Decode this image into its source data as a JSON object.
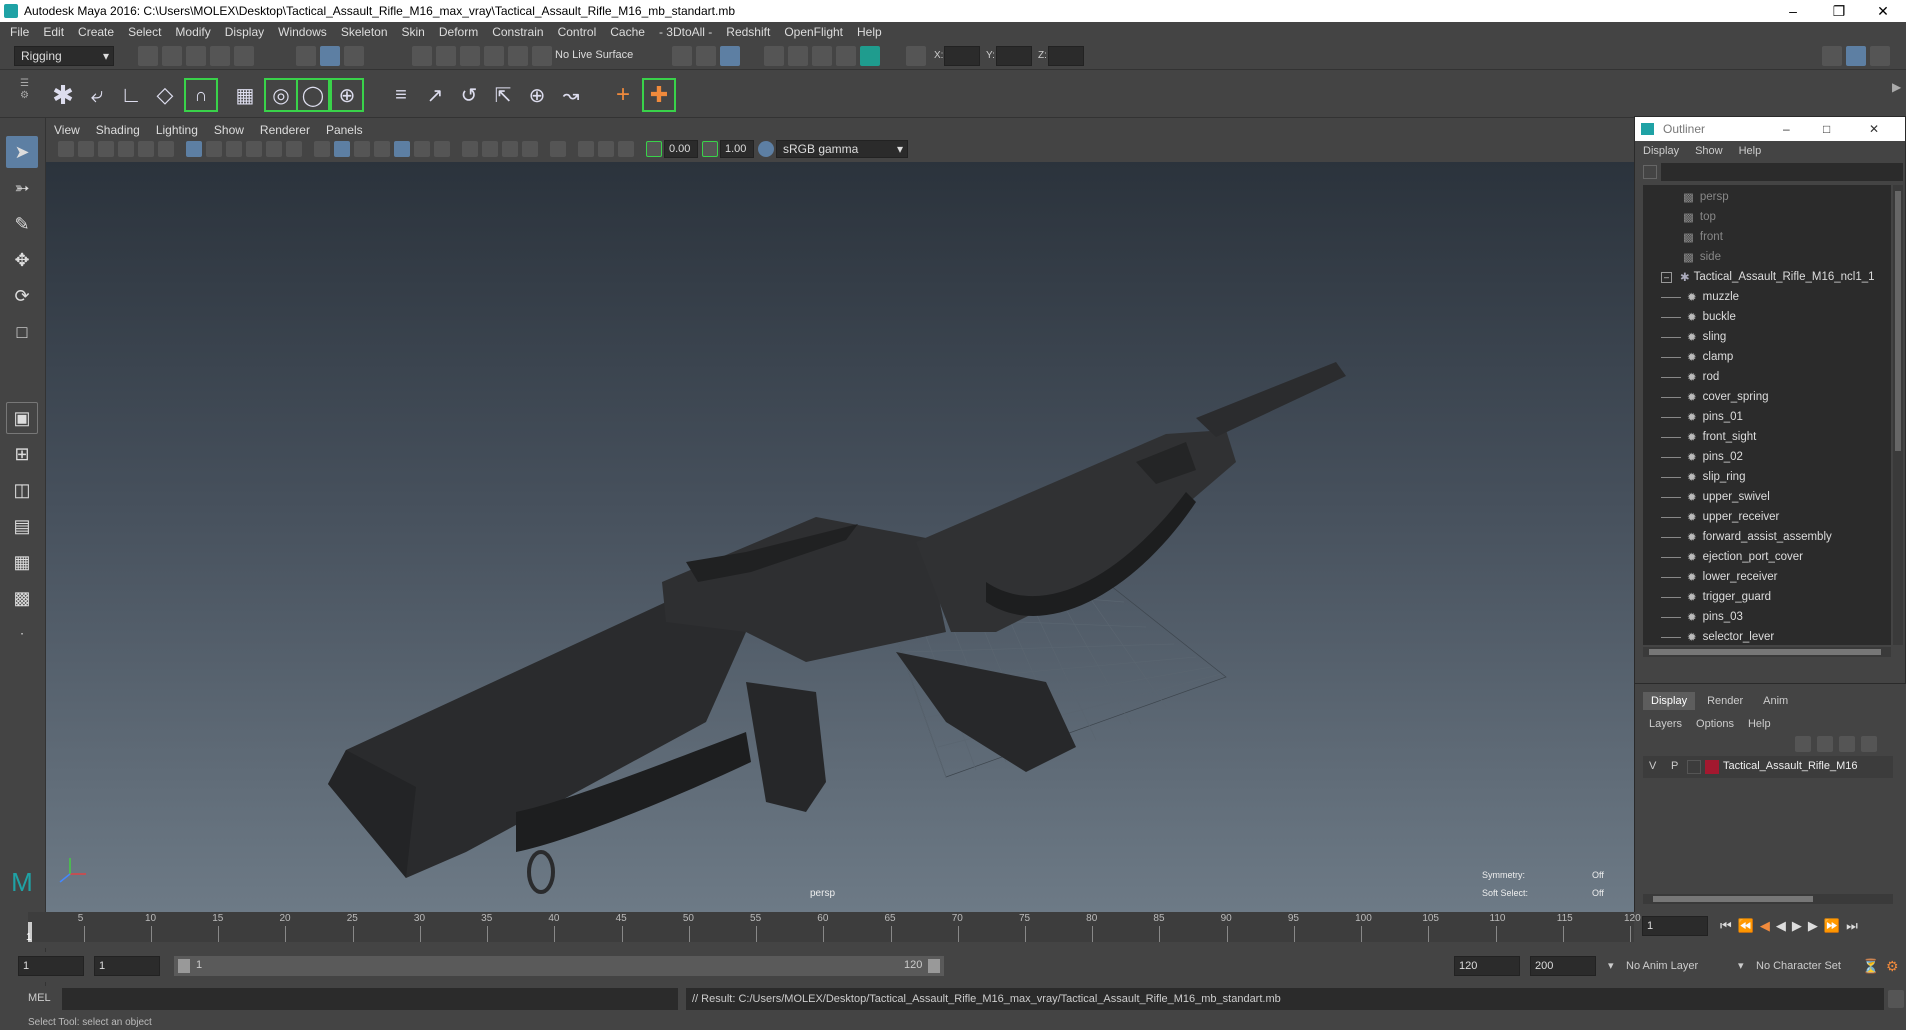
{
  "window": {
    "title": "Autodesk Maya 2016: C:\\Users\\MOLEX\\Desktop\\Tactical_Assault_Rifle_M16_max_vray\\Tactical_Assault_Rifle_M16_mb_standart.mb"
  },
  "menubar": [
    "File",
    "Edit",
    "Create",
    "Select",
    "Modify",
    "Display",
    "Windows",
    "Skeleton",
    "Skin",
    "Deform",
    "Constrain",
    "Control",
    "Cache",
    "- 3DtoAll -",
    "Redshift",
    "OpenFlight",
    "Help"
  ],
  "statusline": {
    "mode": "Rigging",
    "live_surface": "No Live Surface",
    "x_label": "X:",
    "y_label": "Y:",
    "z_label": "Z:"
  },
  "panel": {
    "menu": [
      "View",
      "Shading",
      "Lighting",
      "Show",
      "Renderer",
      "Panels"
    ],
    "near_value": "0.00",
    "far_value": "1.00",
    "color_space": "sRGB gamma",
    "camera_label": "persp",
    "hud": {
      "symmetry_label": "Symmetry:",
      "symmetry_value": "Off",
      "soft_select_label": "Soft Select:",
      "soft_select_value": "Off"
    }
  },
  "outliner": {
    "title": "Outliner",
    "menu": [
      "Display",
      "Show",
      "Help"
    ],
    "cameras": [
      "persp",
      "top",
      "front",
      "side"
    ],
    "group": "Tactical_Assault_Rifle_M16_ncl1_1",
    "children": [
      "muzzle",
      "buckle",
      "sling",
      "clamp",
      "rod",
      "cover_spring",
      "pins_01",
      "front_sight",
      "pins_02",
      "slip_ring",
      "upper_swivel",
      "upper_receiver",
      "forward_assist_assembly",
      "ejection_port_cover",
      "lower_receiver",
      "trigger_guard",
      "pins_03",
      "selector_lever"
    ]
  },
  "layers": {
    "tabs": [
      "Display",
      "Render",
      "Anim"
    ],
    "active_tab": "Display",
    "menu": [
      "Layers",
      "Options",
      "Help"
    ],
    "layer": {
      "v": "V",
      "p": "P",
      "name": "Tactical_Assault_Rifle_M16",
      "color": "#a3182f"
    }
  },
  "timeline": {
    "ticks": [
      "5",
      "10",
      "15",
      "20",
      "25",
      "30",
      "35",
      "40",
      "45",
      "50",
      "55",
      "60",
      "65",
      "70",
      "75",
      "80",
      "85",
      "90",
      "95",
      "100",
      "105",
      "110",
      "115",
      "120"
    ],
    "start_tick": "1",
    "current_frame": "1"
  },
  "range": {
    "start": "1",
    "anim_start": "1",
    "slider_start": "1",
    "slider_end": "120",
    "anim_end": "120",
    "end": "200",
    "anim_layer": "No Anim Layer",
    "character_set": "No Character Set"
  },
  "command": {
    "lang": "MEL",
    "result": "// Result: C:/Users/MOLEX/Desktop/Tactical_Assault_Rifle_M16_max_vray/Tactical_Assault_Rifle_M16_mb_standart.mb"
  },
  "help": "Select Tool: select an object",
  "colors": {
    "accent": "#5d7fa3",
    "maya_teal": "#1fa2a5",
    "shelf_green": "#39d24a"
  }
}
